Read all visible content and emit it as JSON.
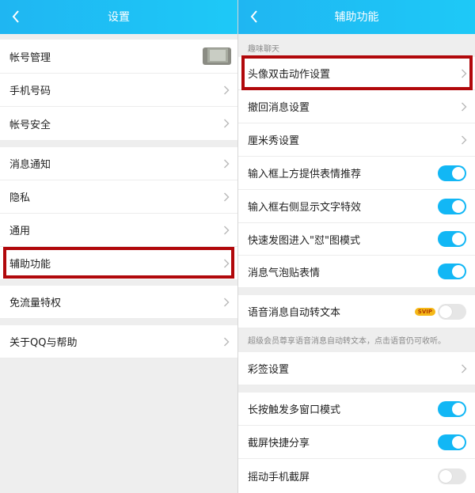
{
  "left": {
    "title": "设置",
    "items": [
      {
        "label": "帐号管理"
      },
      {
        "label": "手机号码"
      },
      {
        "label": "帐号安全"
      },
      {
        "label": "消息通知"
      },
      {
        "label": "隐私"
      },
      {
        "label": "通用"
      },
      {
        "label": "辅助功能"
      },
      {
        "label": "免流量特权"
      },
      {
        "label": "关于QQ与帮助"
      }
    ]
  },
  "right": {
    "title": "辅助功能",
    "section_label": "趣味聊天",
    "items": [
      {
        "label": "头像双击动作设置",
        "control": "chevron"
      },
      {
        "label": "撤回消息设置",
        "control": "chevron"
      },
      {
        "label": "厘米秀设置",
        "control": "chevron"
      },
      {
        "label": "输入框上方提供表情推荐",
        "control": "toggle",
        "on": true
      },
      {
        "label": "输入框右侧显示文字特效",
        "control": "toggle",
        "on": true
      },
      {
        "label": "快速发图进入\"怼\"图模式",
        "control": "toggle",
        "on": true
      },
      {
        "label": "消息气泡贴表情",
        "control": "toggle",
        "on": true
      },
      {
        "label": "语音消息自动转文本",
        "control": "toggle",
        "on": false,
        "badge": "SVIP"
      },
      {
        "label": "彩签设置",
        "control": "chevron"
      },
      {
        "label": "长按触发多窗口模式",
        "control": "toggle",
        "on": true
      },
      {
        "label": "截屏快捷分享",
        "control": "toggle",
        "on": true
      },
      {
        "label": "摇动手机截屏",
        "control": "toggle",
        "on": false
      }
    ],
    "voice_tip": "超级会员尊享语音消息自动转文本，点击语音仍可收听。"
  },
  "colors": {
    "header": "#1fb6f2",
    "toggle_on": "#12b7f5",
    "toggle_off": "#e6e6e6",
    "highlight": "#b1080b",
    "svip_badge": "#f5b817"
  },
  "icons": {
    "back": "chevron-left-icon",
    "row_arrow": "chevron-right-icon"
  }
}
